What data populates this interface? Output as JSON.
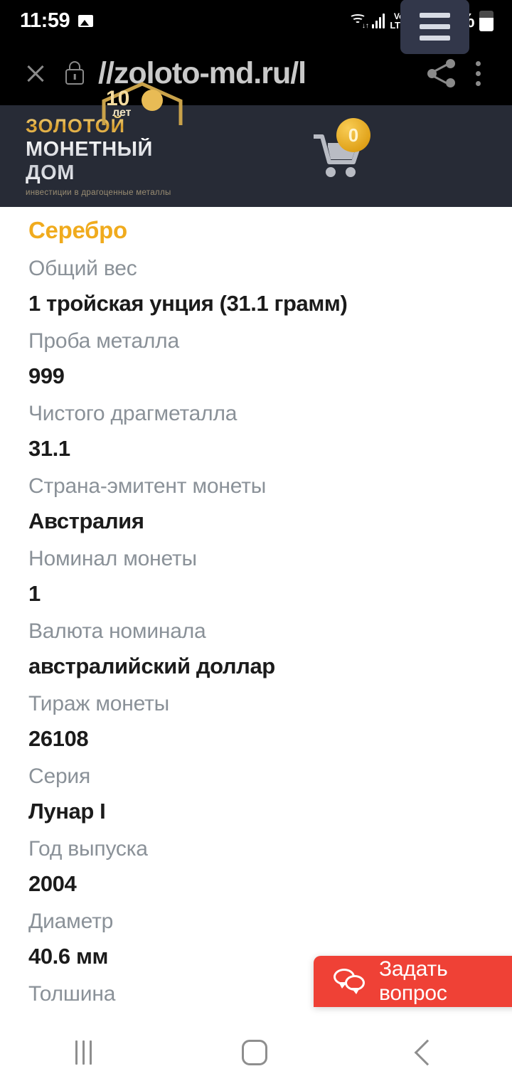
{
  "status_bar": {
    "time": "11:59",
    "photo_icon": "photo-icon",
    "wifi_icon": "wifi-icon",
    "signal_icon": "signal-bars-icon",
    "volte_line1": "Vo)",
    "volte_line2": "LTE2",
    "battery_percent": "63%",
    "battery_level": 63
  },
  "browser": {
    "close_icon": "close-icon",
    "lock_icon": "lock-icon",
    "url": "//zoloto-md.ru/l",
    "share_icon": "share-icon",
    "more_icon": "more-vertical-icon"
  },
  "site_header": {
    "logo_line1": "ЗОЛОТОЙ",
    "logo_line2": "МОНЕТНЫЙ ДОМ",
    "logo_tagline": "инвестиции в драгоценные металлы",
    "logo_badge_number": "10",
    "logo_badge_word": "лет",
    "cart_icon": "cart-icon",
    "cart_count": "0",
    "menu_icon": "hamburger-menu-icon",
    "bg_color": "#272b36",
    "accent_color": "#d79d2a"
  },
  "product_specs": {
    "title": "Серебро",
    "title_color": "#f0ab1d",
    "rows": [
      {
        "label": "Общий вес",
        "value": "1 тройская унция (31.1 грамм)"
      },
      {
        "label": "Проба металла",
        "value": "999"
      },
      {
        "label": "Чистого драгметалла",
        "value": "31.1"
      },
      {
        "label": "Страна-эмитент монеты",
        "value": "Австралия"
      },
      {
        "label": "Номинал монеты",
        "value": "1"
      },
      {
        "label": "Валюта номинала",
        "value": "австралийский доллар"
      },
      {
        "label": "Тираж монеты",
        "value": "26108"
      },
      {
        "label": "Серия",
        "value": "Лунар I"
      },
      {
        "label": "Год выпуска",
        "value": "2004"
      },
      {
        "label": "Диаметр",
        "value": "40.6 мм"
      },
      {
        "label": "Толшина",
        "value": ""
      }
    ]
  },
  "chat_widget": {
    "label": "Задать вопрос",
    "icon": "chat-bubbles-icon",
    "color": "#ef4136"
  },
  "android_nav": {
    "recents_icon": "recents-icon",
    "home_icon": "home-icon",
    "back_icon": "back-icon"
  }
}
